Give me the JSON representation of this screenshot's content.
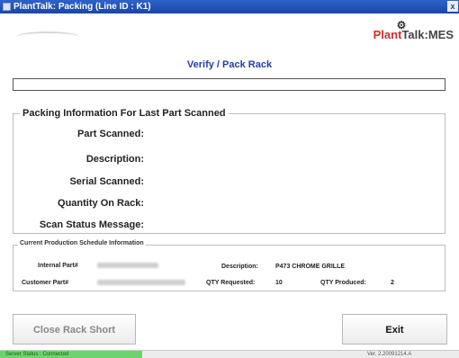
{
  "window": {
    "title": "PlantTalk: Packing (Line ID : K1)",
    "close_glyph": "x"
  },
  "header": {
    "logo_text_part1": "Plant",
    "logo_text_part2": "Talk:MES"
  },
  "page": {
    "title": "Verify / Pack Rack"
  },
  "scan_input": {
    "value": ""
  },
  "packing_info": {
    "legend": "Packing Information For Last Part Scanned",
    "labels": {
      "part_scanned": "Part Scanned:",
      "description": "Description:",
      "serial_scanned": "Serial Scanned:",
      "quantity_on_rack": "Quantity On Rack:",
      "scan_status_message": "Scan Status Message:"
    }
  },
  "schedule": {
    "legend": "Current Production Schedule Information",
    "internal_part_label": "Internal Part#",
    "customer_part_label": "Customer Part#",
    "description_label": "Description:",
    "description_value": "P473 CHROME GRILLE",
    "qty_requested_label": "QTY Requested:",
    "qty_requested_value": "10",
    "qty_produced_label": "QTY Produced:",
    "qty_produced_value": "2"
  },
  "buttons": {
    "close_rack_short": "Close Rack Short",
    "exit": "Exit"
  },
  "status": {
    "connection": "Server Status : Connected",
    "version": "Ver. 2.20091214.A"
  },
  "colors": {
    "titlebar": "#1a46a8",
    "page_title": "#1f3fb3",
    "status_connected": "#6cd46c",
    "logo_red": "#d92b2b"
  }
}
